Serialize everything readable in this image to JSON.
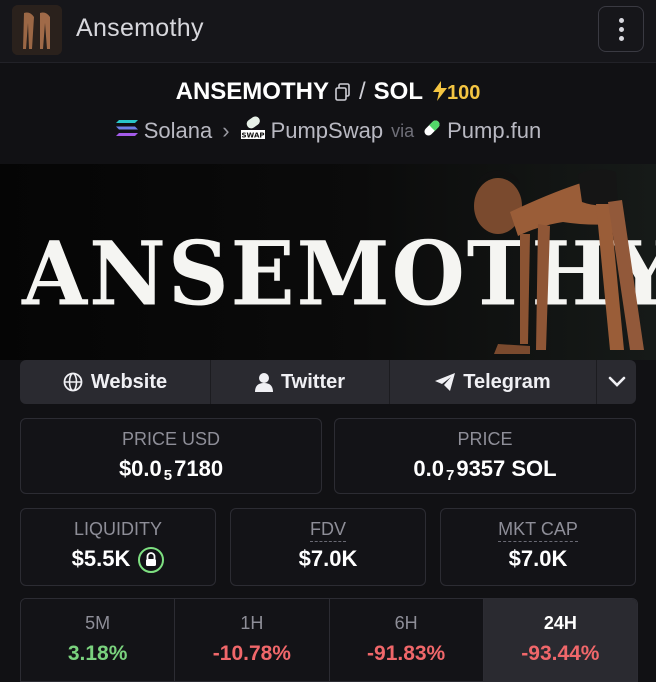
{
  "header": {
    "title": "Ansemothy"
  },
  "pair": {
    "base": "ANSEMOTHY",
    "separator": "/",
    "quote": "SOL",
    "boost": "100"
  },
  "chain": {
    "network": "Solana",
    "dex": "PumpSwap",
    "via_label": "via",
    "launchpad": "Pump.fun",
    "swap_badge": "SWAP"
  },
  "banner": {
    "text": "ANSEMOTHY"
  },
  "links": {
    "website": "Website",
    "twitter": "Twitter",
    "telegram": "Telegram"
  },
  "stats": {
    "price_usd": {
      "label": "PRICE USD",
      "prefix": "$0.0",
      "zeros": "5",
      "digits": "7180"
    },
    "price_native": {
      "label": "PRICE",
      "prefix": "0.0",
      "zeros": "7",
      "digits": "9357 SOL"
    },
    "liquidity": {
      "label": "LIQUIDITY",
      "value": "$5.5K"
    },
    "fdv": {
      "label": "FDV",
      "value": "$7.0K"
    },
    "mkt_cap": {
      "label": "MKT CAP",
      "value": "$7.0K"
    }
  },
  "timeframes": [
    {
      "label": "5M",
      "value": "3.18%"
    },
    {
      "label": "1H",
      "value": "-10.78%"
    },
    {
      "label": "6H",
      "value": "-91.83%"
    },
    {
      "label": "24H",
      "value": "-93.44%"
    }
  ],
  "colors": {
    "positive": "#7ad27e",
    "negative": "#f0676a",
    "boost": "#f4c542",
    "selected_tab": "#2a2a30"
  },
  "icons": {
    "menu": "kebab-menu-icon",
    "copy": "copy-icon",
    "boost": "lightning-icon",
    "website": "globe-icon",
    "twitter": "user-icon",
    "telegram": "paper-plane-icon",
    "expand": "chevron-down-icon",
    "lock": "lock-icon"
  }
}
